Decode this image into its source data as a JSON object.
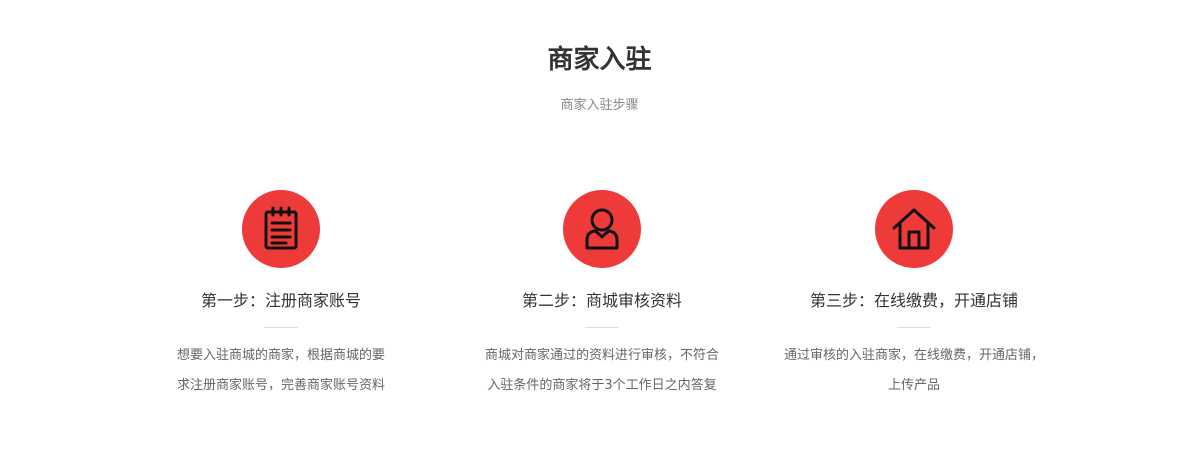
{
  "section": {
    "title": "商家入驻",
    "subtitle": "商家入驻步骤"
  },
  "theme": {
    "accent": "#ef3a3a",
    "icon_stroke": "#111111"
  },
  "steps": [
    {
      "icon": "notepad-icon",
      "title": "第一步：注册商家账号",
      "desc_lines": [
        "想要入驻商城的商家，根据商城的要",
        "求注册商家账号，完善商家账号资料"
      ]
    },
    {
      "icon": "user-icon",
      "title": "第二步：商城审核资料",
      "desc_lines": [
        "商城对商家通过的资料进行审核，不符合",
        "入驻条件的商家将于3个工作日之内答复"
      ]
    },
    {
      "icon": "house-icon",
      "title": "第三步：在线缴费，开通店铺",
      "desc_lines": [
        "通过审核的入驻商家，在线缴费，开通店铺，",
        "上传产品"
      ]
    }
  ]
}
